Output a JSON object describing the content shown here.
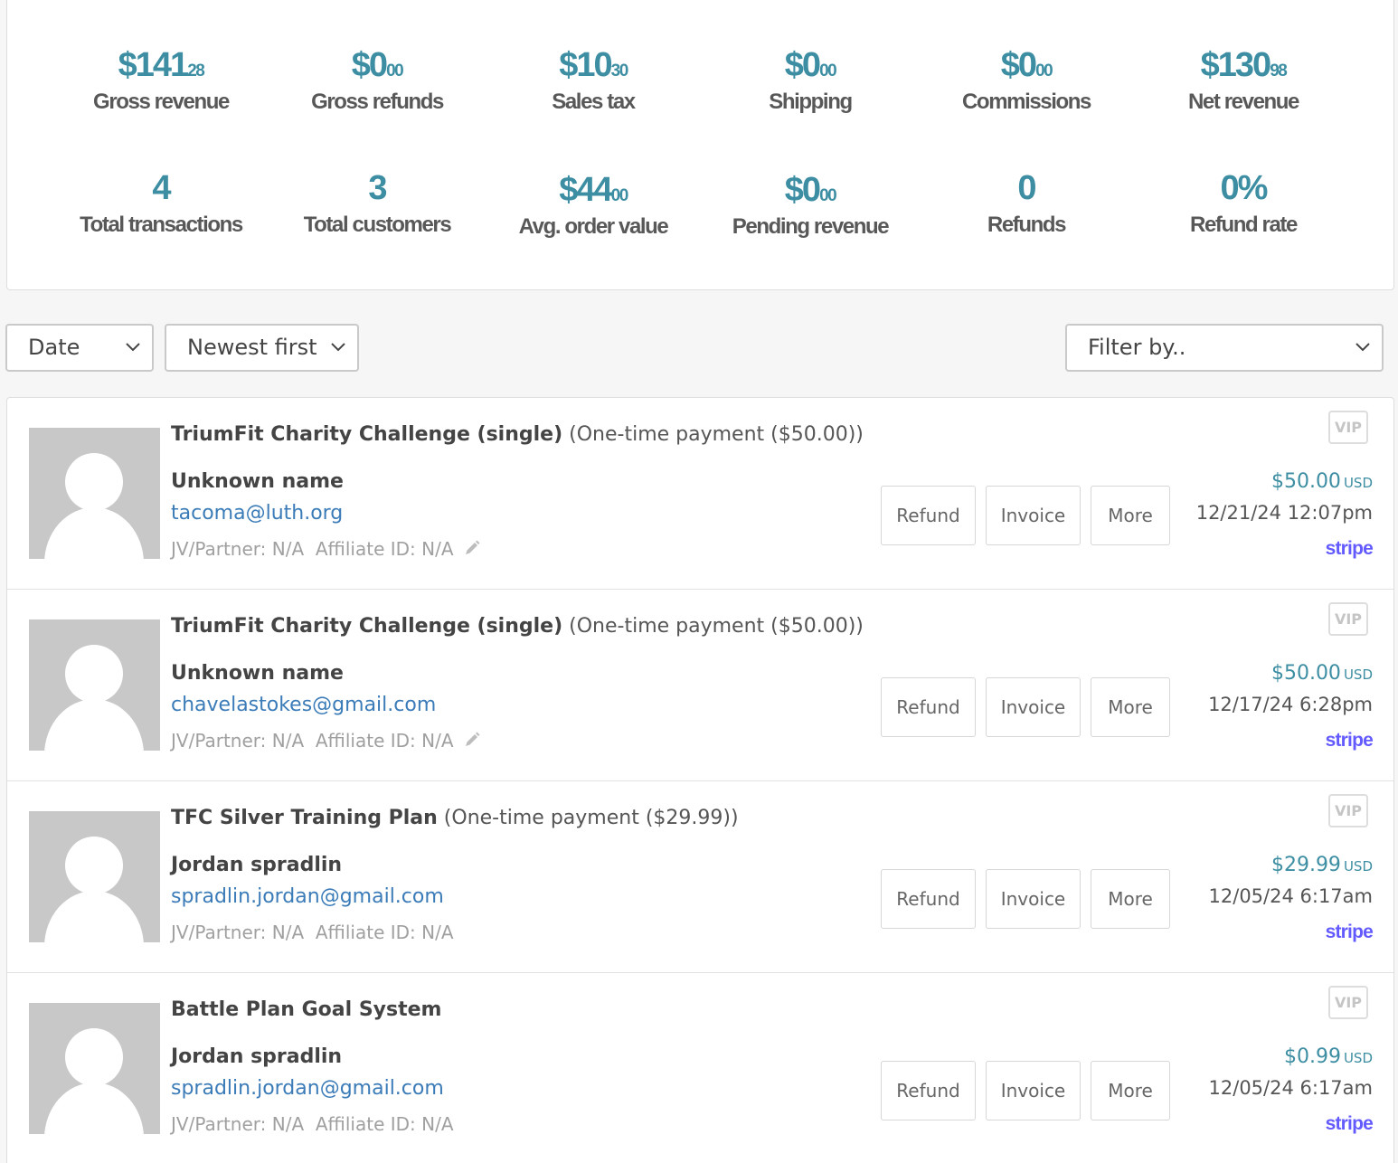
{
  "stats": [
    {
      "value": "$141",
      "cents": "28",
      "label": "Gross revenue"
    },
    {
      "value": "$0",
      "cents": "00",
      "label": "Gross refunds"
    },
    {
      "value": "$10",
      "cents": "30",
      "label": "Sales tax"
    },
    {
      "value": "$0",
      "cents": "00",
      "label": "Shipping"
    },
    {
      "value": "$0",
      "cents": "00",
      "label": "Commissions"
    },
    {
      "value": "$130",
      "cents": "98",
      "label": "Net revenue"
    },
    {
      "value": "4",
      "cents": "",
      "label": "Total transactions"
    },
    {
      "value": "3",
      "cents": "",
      "label": "Total customers"
    },
    {
      "value": "$44",
      "cents": "00",
      "label": "Avg. order value"
    },
    {
      "value": "$0",
      "cents": "00",
      "label": "Pending revenue"
    },
    {
      "value": "0",
      "cents": "",
      "label": "Refunds"
    },
    {
      "value": "0%",
      "cents": "",
      "label": "Refund rate"
    }
  ],
  "toolbar": {
    "sort_field": "Date",
    "sort_order": "Newest first",
    "filter": "Filter by.."
  },
  "labels": {
    "refund": "Refund",
    "invoice": "Invoice",
    "more": "More",
    "vip": "VIP",
    "stripe": "stripe"
  },
  "transactions": [
    {
      "product": "TriumFit Charity Challenge (single)",
      "plan": " (One-time payment ($50.00))",
      "customer": "Unknown name",
      "email": "tacoma@luth.org",
      "meta": "JV/Partner: N/A  Affiliate ID: N/A",
      "amount": "$50.00",
      "currency": "USD",
      "date": "12/21/24 12:07pm"
    },
    {
      "product": "TriumFit Charity Challenge (single)",
      "plan": " (One-time payment ($50.00))",
      "customer": "Unknown name",
      "email": "chavelastokes@gmail.com",
      "meta": "JV/Partner: N/A  Affiliate ID: N/A",
      "amount": "$50.00",
      "currency": "USD",
      "date": "12/17/24 6:28pm"
    },
    {
      "product": "TFC Silver Training Plan",
      "plan": " (One-time payment ($29.99))",
      "customer": "Jordan spradlin",
      "email": "spradlin.jordan@gmail.com",
      "meta": "JV/Partner: N/A  Affiliate ID: N/A",
      "amount": "$29.99",
      "currency": "USD",
      "date": "12/05/24 6:17am"
    },
    {
      "product": "Battle Plan Goal System",
      "plan": "",
      "customer": "Jordan spradlin",
      "email": "spradlin.jordan@gmail.com",
      "meta": "JV/Partner: N/A  Affiliate ID: N/A",
      "amount": "$0.99",
      "currency": "USD",
      "date": "12/05/24 6:17am"
    }
  ]
}
